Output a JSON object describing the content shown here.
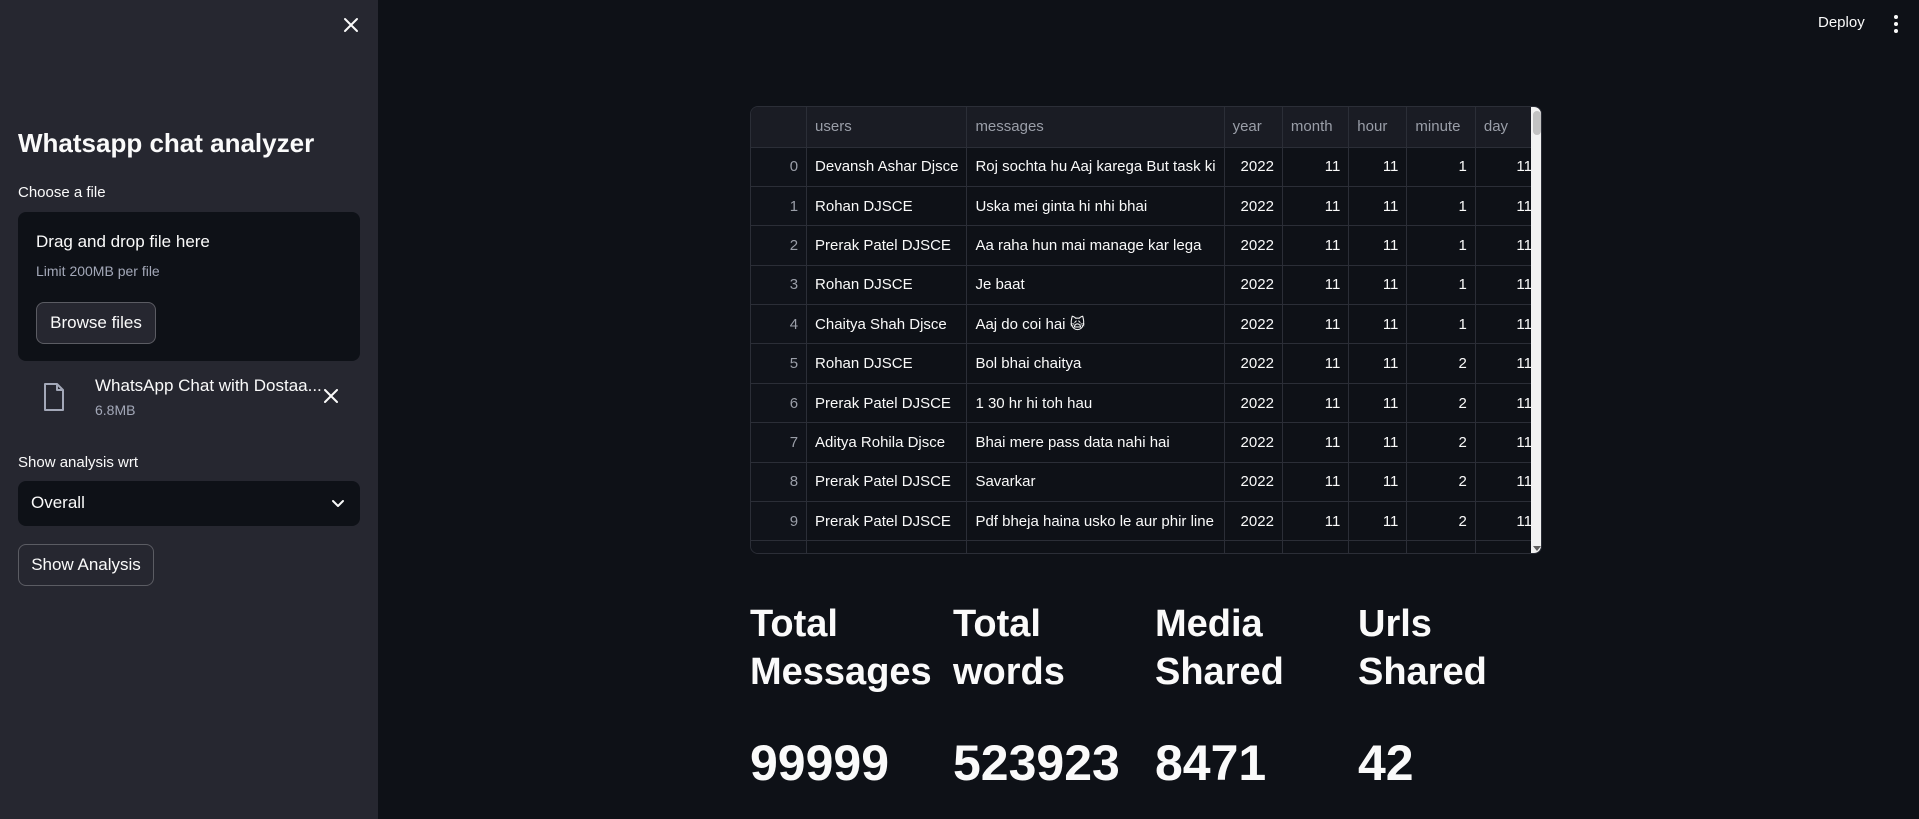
{
  "sidebar": {
    "title": "Whatsapp chat analyzer",
    "choose_file_label": "Choose a file",
    "dropzone": {
      "title": "Drag and drop file here",
      "limit": "Limit 200MB per file",
      "browse_label": "Browse files"
    },
    "uploaded_file": {
      "name": "WhatsApp Chat with Dostaa...",
      "size": "6.8MB"
    },
    "analysis_label": "Show analysis wrt",
    "analysis_selected": "Overall",
    "show_button": "Show Analysis"
  },
  "header": {
    "deploy_label": "Deploy"
  },
  "table": {
    "columns": [
      "",
      "users",
      "messages",
      "year",
      "month",
      "hour",
      "minute",
      "day"
    ],
    "rows": [
      [
        "0",
        "Devansh Ashar Djsce",
        "Roj sochta hu Aaj karega But task ki",
        "2022",
        "11",
        "11",
        "1",
        "11"
      ],
      [
        "1",
        "Rohan DJSCE",
        "Uska mei ginta hi nhi bhai",
        "2022",
        "11",
        "11",
        "1",
        "11"
      ],
      [
        "2",
        "Prerak Patel DJSCE",
        "Aa raha hun mai manage kar lega",
        "2022",
        "11",
        "11",
        "1",
        "11"
      ],
      [
        "3",
        "Rohan DJSCE",
        "Je baat",
        "2022",
        "11",
        "11",
        "1",
        "11"
      ],
      [
        "4",
        "Chaitya Shah Djsce",
        "Aaj do coi hai 🙀",
        "2022",
        "11",
        "11",
        "1",
        "11"
      ],
      [
        "5",
        "Rohan DJSCE",
        "Bol bhai chaitya",
        "2022",
        "11",
        "11",
        "2",
        "11"
      ],
      [
        "6",
        "Prerak Patel DJSCE",
        "1 30 hr hi toh hau",
        "2022",
        "11",
        "11",
        "2",
        "11"
      ],
      [
        "7",
        "Aditya Rohila Djsce",
        "Bhai mere pass data nahi hai",
        "2022",
        "11",
        "11",
        "2",
        "11"
      ],
      [
        "8",
        "Prerak Patel DJSCE",
        "Savarkar",
        "2022",
        "11",
        "11",
        "2",
        "11"
      ],
      [
        "9",
        "Prerak Patel DJSCE",
        "Pdf bheja haina usko le aur phir line",
        "2022",
        "11",
        "11",
        "2",
        "11"
      ]
    ]
  },
  "metrics": [
    {
      "label_line1": "Total",
      "label_line2": "Messages",
      "value": "99999"
    },
    {
      "label_line1": "Total",
      "label_line2": "words",
      "value": "523923"
    },
    {
      "label_line1": "Media",
      "label_line2": "Shared",
      "value": "8471"
    },
    {
      "label_line1": "Urls",
      "label_line2": "Shared",
      "value": "42"
    }
  ],
  "icons": {
    "sidebar_close": "close-icon",
    "file": "file-icon",
    "file_remove": "close-icon",
    "select_chevron": "chevron-down-icon",
    "menu": "kebab-menu-icon"
  },
  "colors": {
    "background": "#0e1117",
    "sidebar": "#262730",
    "text": "#fafafa"
  }
}
